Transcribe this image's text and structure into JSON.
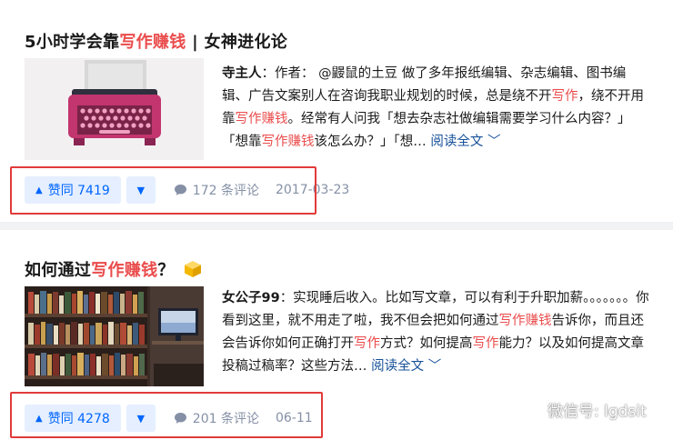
{
  "posts": [
    {
      "title_prefix": "5小时学会靠",
      "title_highlight": "写作赚钱",
      "title_suffix": " | 女神进化论",
      "author": "寺主人",
      "excerpt_parts": [
        "：作者： @鼹鼠的土豆 做了多年报纸编辑、杂志编辑、图书编辑、广告文案别人在咨询我职业规划的时候，总是绕不开",
        "写作",
        "，绕不开用靠",
        "写作赚钱",
        "。经常有人问我「想去杂志社做编辑需要学习什么内容？」「想靠",
        "写作赚钱",
        "该怎么办？」「想… "
      ],
      "read_more": "阅读全文",
      "upvote_label": "赞同 7419",
      "comments_label": "172 条评论",
      "date": "2017-03-23"
    },
    {
      "title_prefix": "如何通过",
      "title_highlight": "写作赚钱",
      "title_suffix": "？",
      "author": "女公子99",
      "excerpt_parts": [
        "：实现睡后收入。比如写文章，可以有利于升职加薪。。。。。。。你看到这里，就不用走了啦，我不但会把如何通过",
        "写作赚钱",
        "告诉你，而且还会告诉你如何正确打开",
        "写作",
        "方式？如何提高",
        "写作",
        "能力？以及如何提高文章投稿过稿率？这些方法… "
      ],
      "read_more": "阅读全文",
      "upvote_label": "赞同 4278",
      "comments_label": "201 条评论",
      "date": "06-11"
    }
  ],
  "watermark": "微信号: lgdsit",
  "icons": [
    "upvote-triangle-icon",
    "downvote-triangle-icon",
    "comment-bubble-icon",
    "chevron-down-icon",
    "cube-emoji-icon",
    "wechat-icon"
  ],
  "colors": {
    "highlight": "#ea4c4c",
    "vote": "#0066ff",
    "vote_bg": "#e5efff",
    "link": "#175199",
    "meta": "#8590a6",
    "annotation_box": "#e23a3a"
  }
}
